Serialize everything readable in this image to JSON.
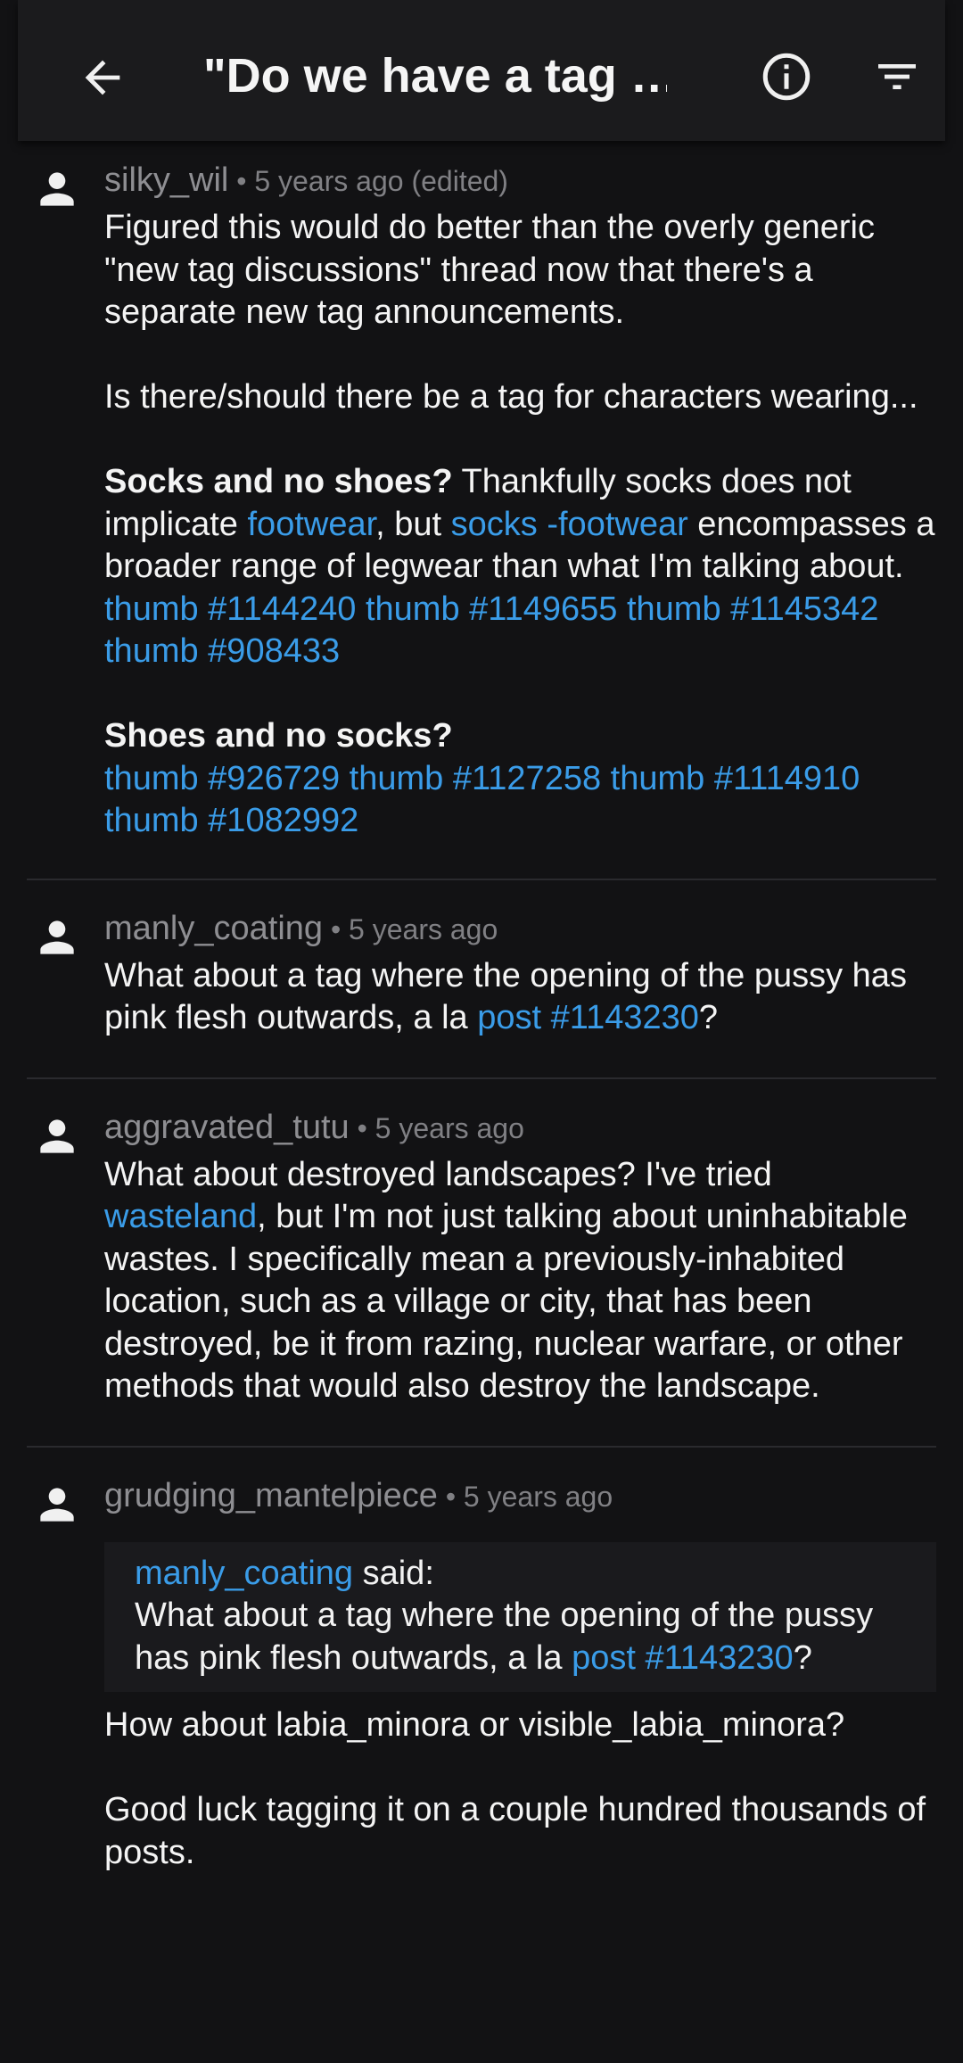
{
  "appbar": {
    "title": "\"Do we have a tag …",
    "back_icon": "arrow-left-icon",
    "info_icon": "info-icon",
    "filter_icon": "filter-icon"
  },
  "colors": {
    "background": "#121214",
    "appbar": "#1b1b1d",
    "link": "#3a9ce8",
    "muted": "#8e8e92"
  },
  "comments": [
    {
      "user": "silky_wil",
      "time": "5 years ago (edited)",
      "p1": "Figured this would do better than the overly generic \"new tag discussions\" thread now that there's a separate new tag announcements.",
      "p2": "Is there/should there be a tag for characters wearing...",
      "p3_bold": "Socks and no shoes?",
      "p3_a": " Thankfully socks does not implicate ",
      "p3_link1": "footwear",
      "p3_b": ", but ",
      "p3_link2": "socks -footwear",
      "p3_c": " encompasses a broader range of legwear than what I'm talking about.",
      "thumbs1": [
        "thumb #1144240",
        "thumb #1149655",
        "thumb #1145342",
        "thumb #908433"
      ],
      "p4_bold": "Shoes and no socks?",
      "thumbs2": [
        "thumb #926729",
        "thumb #1127258",
        "thumb #1114910",
        "thumb #1082992"
      ]
    },
    {
      "user": "manly_coating",
      "time": "5 years ago",
      "text_a": "What about a tag where the opening of the pussy has pink flesh outwards, a la ",
      "link": "post #1143230",
      "text_b": "?"
    },
    {
      "user": "aggravated_tutu",
      "time": "5 years ago",
      "text_a": "What about destroyed landscapes? I've tried ",
      "link": "wasteland",
      "text_b": ", but I'm not just talking about uninhabitable wastes. I specifically mean a previously-inhabited location, such as a village or city, that has been destroyed, be it from razing, nuclear warfare, or other methods that would also destroy the landscape."
    },
    {
      "user": "grudging_mantelpiece",
      "time": "5 years ago",
      "quote_user": "manly_coating",
      "quote_said": " said:",
      "quote_a": "What about a tag where the opening of the pussy has pink flesh outwards, a la ",
      "quote_link": "post #1143230",
      "quote_b": "?",
      "p1": "How about labia_minora or visible_labia_minora?",
      "p2": "Good luck tagging it on a couple hundred thousands of posts."
    }
  ]
}
